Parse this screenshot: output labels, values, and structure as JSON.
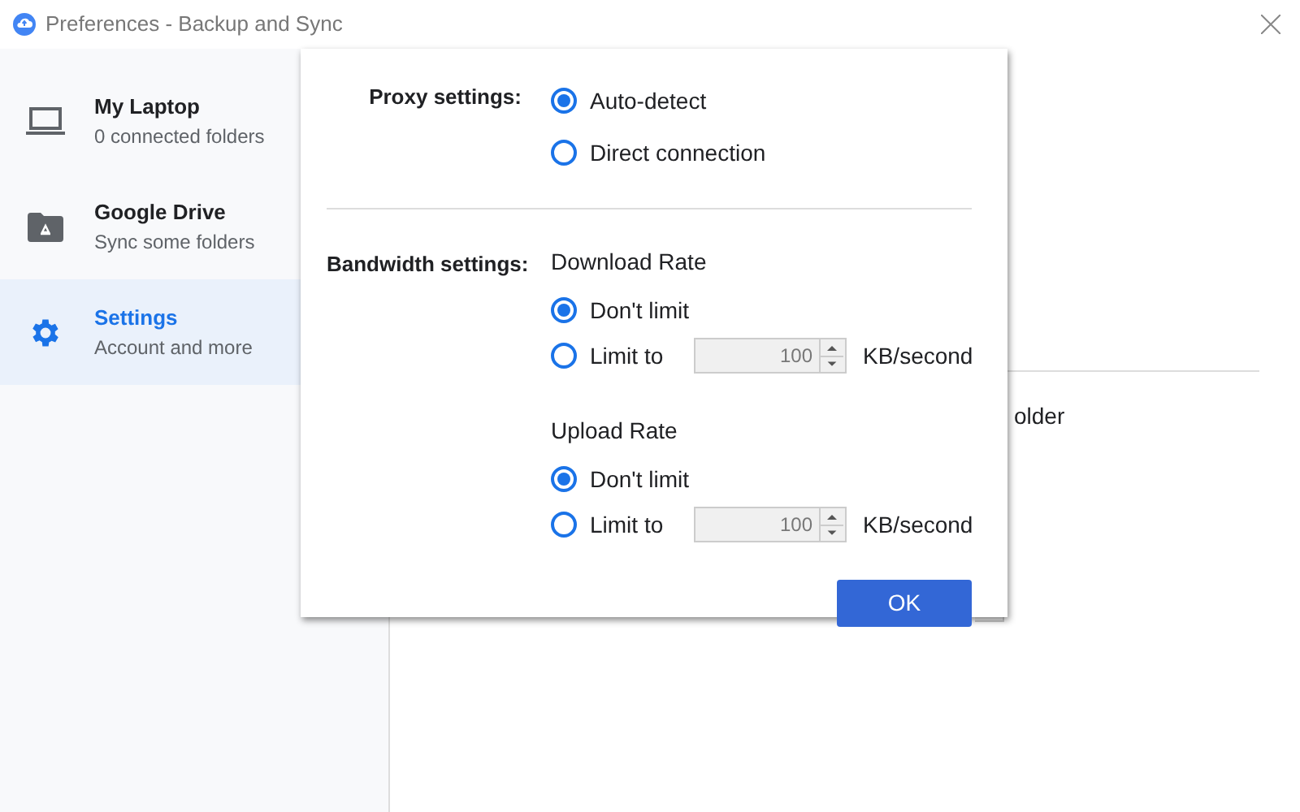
{
  "window": {
    "title": "Preferences - Backup and Sync"
  },
  "sidebar": {
    "items": [
      {
        "title": "My Laptop",
        "subtitle": "0 connected folders",
        "selected": false
      },
      {
        "title": "Google Drive",
        "subtitle": "Sync some folders",
        "selected": false
      },
      {
        "title": "Settings",
        "subtitle": "Account and more",
        "selected": true
      }
    ]
  },
  "background": {
    "text": "older"
  },
  "dialog": {
    "proxy": {
      "label": "Proxy settings:",
      "options": [
        {
          "label": "Auto-detect",
          "selected": true
        },
        {
          "label": "Direct connection",
          "selected": false
        }
      ]
    },
    "bandwidth": {
      "label": "Bandwidth settings:",
      "rates": [
        {
          "heading": "Download Rate",
          "options": [
            {
              "kind": "plain",
              "label": "Don't limit",
              "selected": true
            },
            {
              "kind": "limit",
              "label": "Limit to",
              "selected": false,
              "value": "100",
              "disabled": true,
              "unit": "KB/second"
            }
          ]
        },
        {
          "heading": "Upload Rate",
          "options": [
            {
              "kind": "plain",
              "label": "Don't limit",
              "selected": true
            },
            {
              "kind": "limit",
              "label": "Limit to",
              "selected": false,
              "value": "100",
              "disabled": true,
              "unit": "KB/second"
            }
          ]
        }
      ]
    },
    "button": "OK"
  }
}
